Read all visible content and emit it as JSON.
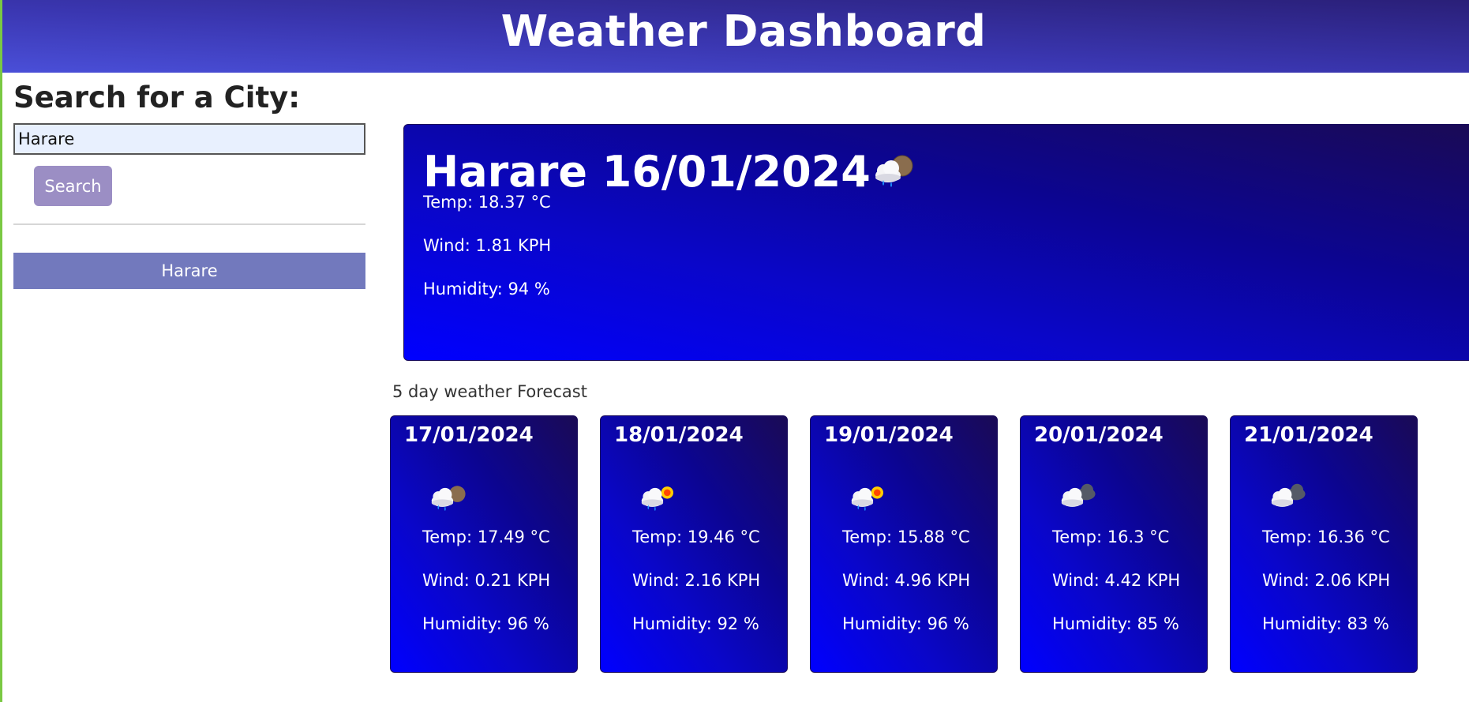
{
  "header": {
    "title": "Weather Dashboard"
  },
  "sidebar": {
    "search_title": "Search for a City:",
    "input_value": "Harare",
    "search_label": "Search",
    "history": [
      {
        "label": "Harare"
      }
    ]
  },
  "current": {
    "title": "Harare 16/01/2024",
    "icon": "rain-cloud-night-icon",
    "temp": "Temp: 18.37 °C",
    "wind": "Wind: 1.81 KPH",
    "humidity": "Humidity: 94 %"
  },
  "forecast": {
    "heading": "5 day weather Forecast",
    "days": [
      {
        "date": "17/01/2024",
        "icon": "rain-cloud-night-icon",
        "temp": "Temp: 17.49 °C",
        "wind": "Wind: 0.21 KPH",
        "humidity": "Humidity: 96 %"
      },
      {
        "date": "18/01/2024",
        "icon": "rain-cloud-sun-icon",
        "temp": "Temp: 19.46 °C",
        "wind": "Wind: 2.16 KPH",
        "humidity": "Humidity: 92 %"
      },
      {
        "date": "19/01/2024",
        "icon": "rain-cloud-sun-icon",
        "temp": "Temp: 15.88 °C",
        "wind": "Wind: 4.96 KPH",
        "humidity": "Humidity: 96 %"
      },
      {
        "date": "20/01/2024",
        "icon": "cloudy-icon",
        "temp": "Temp: 16.3 °C",
        "wind": "Wind: 4.42 KPH",
        "humidity": "Humidity: 85 %"
      },
      {
        "date": "21/01/2024",
        "icon": "cloudy-icon",
        "temp": "Temp: 16.36 °C",
        "wind": "Wind: 2.06 KPH",
        "humidity": "Humidity: 83 %"
      }
    ]
  },
  "colors": {
    "header_start": "#4a4fd8",
    "header_end": "#2a1f78",
    "card_start": "#0000ff",
    "card_end": "#1a0a55",
    "search_button": "#9b8ec4",
    "history_button": "#7279bd",
    "left_border": "#7ac943"
  }
}
